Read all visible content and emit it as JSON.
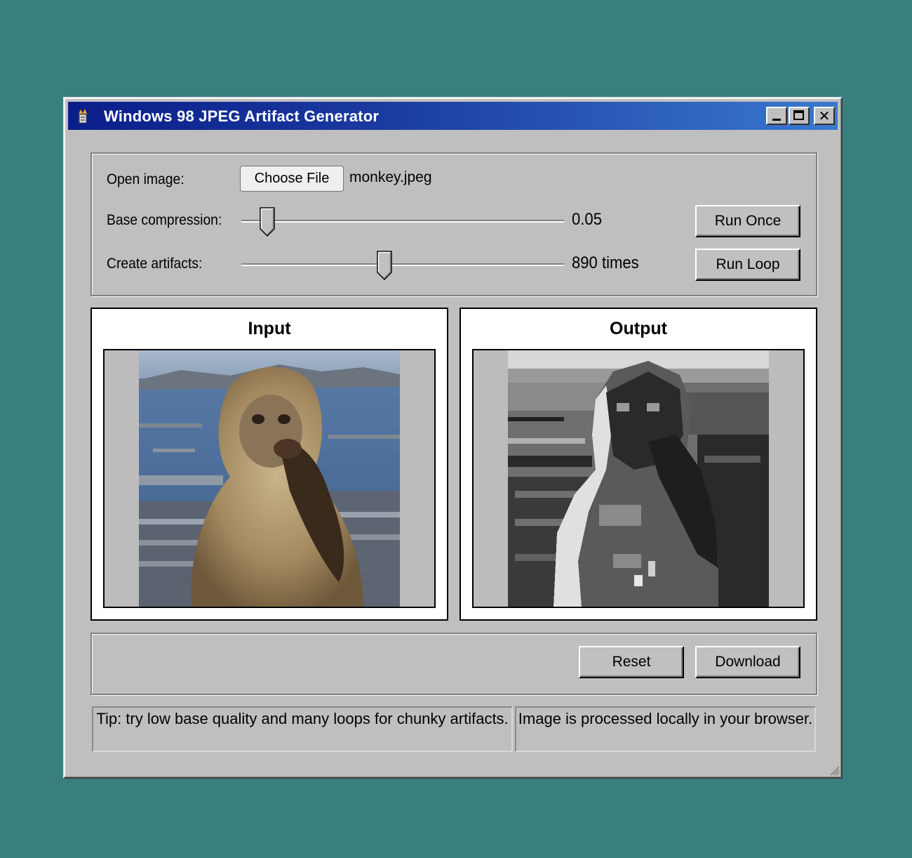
{
  "window": {
    "title": "Windows 98 JPEG Artifact Generator",
    "controls": {
      "minimize": "minimize",
      "maximize": "maximize",
      "close": "✕"
    }
  },
  "form": {
    "open_image_label": "Open image:",
    "choose_file_label": "Choose File",
    "file_name": "monkey.jpeg",
    "base_compression_label": "Base compression:",
    "base_compression_value": "0.05",
    "base_compression_level": 0.06,
    "create_artifacts_label": "Create artifacts:",
    "create_artifacts_value": "890 times",
    "create_artifacts_level": 0.44,
    "run_once_label": "Run Once",
    "run_loop_label": "Run Loop"
  },
  "panels": {
    "input_title": "Input",
    "output_title": "Output"
  },
  "actions": {
    "reset_label": "Reset",
    "download_label": "Download"
  },
  "status": {
    "tip": "Tip: try low base quality and many loops for chunky artifacts.",
    "privacy": "Image is processed locally in your browser."
  },
  "colors": {
    "desktop": "#387f7e",
    "title_gradient_start": "#0a1e8a",
    "title_gradient_end": "#3a78d0",
    "window_face": "#bfbfbf"
  }
}
